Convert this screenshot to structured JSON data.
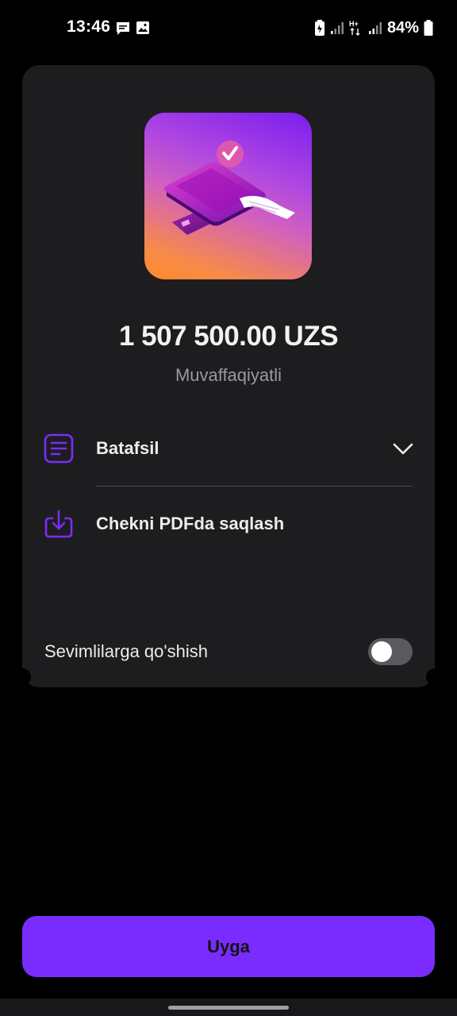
{
  "status_bar": {
    "time": "13:46",
    "battery_percent": "84%",
    "icons": [
      "message-icon",
      "gallery-icon",
      "battery-saver-icon",
      "signal-icon",
      "hplus-data-icon",
      "signal-icon",
      "battery-icon"
    ]
  },
  "receipt": {
    "amount": "1 507 500.00 UZS",
    "status": "Muvaffaqiyatli",
    "details_label": "Batafsil",
    "save_pdf_label": "Chekni PDFda saqlash",
    "favorite_label": "Sevimlilarga qo'shish",
    "favorite_enabled": false
  },
  "footer": {
    "home_button_label": "Uyga"
  },
  "colors": {
    "accent": "#7a2cff",
    "card_bg": "#1d1d1f",
    "background": "#000000",
    "muted_text": "#9a9a9e"
  }
}
